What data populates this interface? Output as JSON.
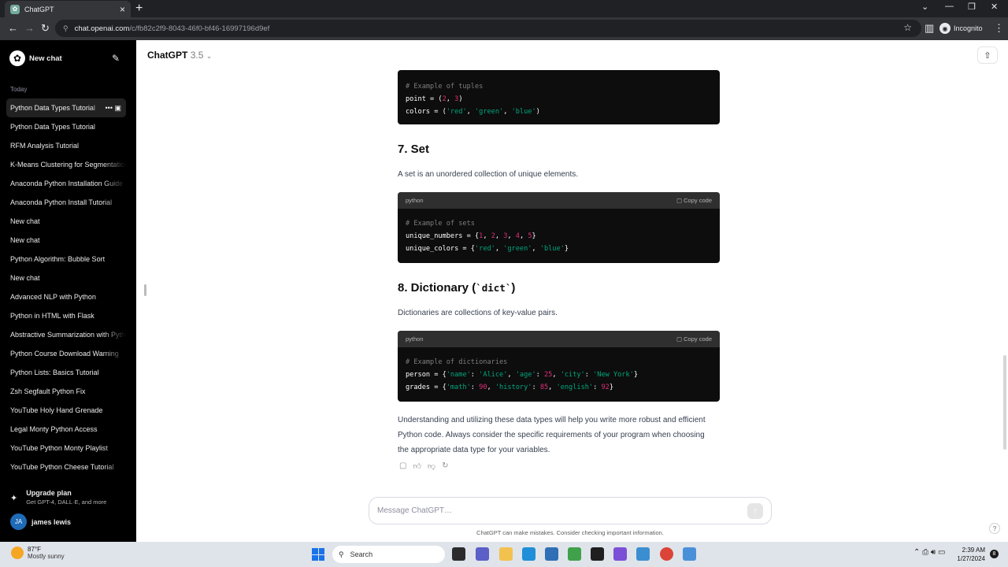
{
  "browser": {
    "tab_title": "ChatGPT",
    "url_host": "chat.openai.com",
    "url_path": "/c/fb82c2f9-8043-46f0-bf46-16997196d9ef",
    "incognito_label": "Incognito"
  },
  "sidebar": {
    "new_chat_label": "New chat",
    "section_label": "Today",
    "items": [
      {
        "label": "Python Data Types Tutorial"
      },
      {
        "label": "Python Data Types Tutorial"
      },
      {
        "label": "RFM Analysis Tutorial"
      },
      {
        "label": "K-Means Clustering for Segmentation"
      },
      {
        "label": "Anaconda Python Installation Guide"
      },
      {
        "label": "Anaconda Python Install Tutorial"
      },
      {
        "label": "New chat"
      },
      {
        "label": "New chat"
      },
      {
        "label": "Python Algorithm: Bubble Sort"
      },
      {
        "label": "New chat"
      },
      {
        "label": "Advanced NLP with Python"
      },
      {
        "label": "Python in HTML with Flask"
      },
      {
        "label": "Abstractive Summarization with Python"
      },
      {
        "label": "Python Course Download Warning"
      },
      {
        "label": "Python Lists: Basics Tutorial"
      },
      {
        "label": "Zsh Segfault Python Fix"
      },
      {
        "label": "YouTube Holy Hand Grenade"
      },
      {
        "label": "Legal Monty Python Access"
      },
      {
        "label": "YouTube Python Monty Playlist"
      },
      {
        "label": "YouTube Python Cheese Tutorial"
      }
    ],
    "upgrade_title": "Upgrade plan",
    "upgrade_sub": "Get GPT-4, DALL·E, and more",
    "user_initials": "JA",
    "user_name": "james lewis"
  },
  "header": {
    "model_name": "ChatGPT",
    "model_version": "3.5"
  },
  "content": {
    "code_tuples": {
      "comment": "# Example of tuples",
      "line1_var": "point = (",
      "line2_var": "colors = ("
    },
    "set_heading": "7. Set",
    "set_desc": "A set is an unordered collection of unique elements.",
    "code_lang": "python",
    "copy_label": "Copy code",
    "code_sets_comment": "# Example of sets",
    "dict_heading_prefix": "8. Dictionary (",
    "dict_heading_code": "`dict`",
    "dict_heading_suffix": ")",
    "dict_desc": "Dictionaries are collections of key-value pairs.",
    "code_dict_comment": "# Example of dictionaries",
    "summary": "Understanding and utilizing these data types will help you write more robust and efficient Python code. Always consider the specific requirements of your program when choosing the appropriate data type for your variables."
  },
  "composer": {
    "placeholder": "Message ChatGPT…",
    "disclaimer": "ChatGPT can make mistakes. Consider checking important information."
  },
  "taskbar": {
    "temp": "87°F",
    "condition": "Mostly sunny",
    "search_label": "Search",
    "time": "2:39 AM",
    "date": "1/27/2024",
    "notification_count": "8"
  },
  "colors": {
    "sidebar_bg": "#000000",
    "code_bg": "#0d0d0d",
    "code_number": "#df3079",
    "code_string": "#00a67d"
  }
}
